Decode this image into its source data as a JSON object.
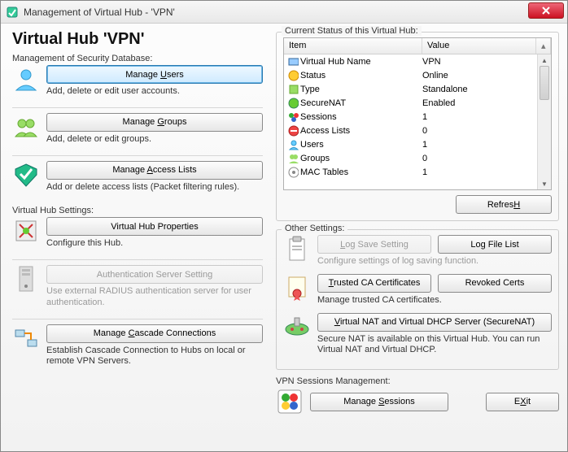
{
  "title": "Management of Virtual Hub - 'VPN'",
  "heading": "Virtual Hub 'VPN'",
  "left": {
    "security_label": "Management of Security Database:",
    "manage_users_btn": "Manage Users",
    "manage_users_u": "U",
    "manage_users_desc": "Add, delete or edit user accounts.",
    "manage_groups_btn": "Manage Groups",
    "manage_groups_u": "G",
    "manage_groups_desc": "Add, delete or edit groups.",
    "manage_acl_btn": "Manage Access Lists",
    "manage_acl_u": "A",
    "manage_acl_desc": "Add or delete access lists (Packet filtering rules).",
    "settings_label": "Virtual Hub Settings:",
    "vhub_props_btn": "Virtual Hub Properties",
    "vhub_props_desc": "Configure this Hub.",
    "auth_server_btn": "Authentication Server Setting",
    "auth_server_desc": "Use external RADIUS authentication server for user authentication.",
    "cascade_btn": "Manage Cascade Connections",
    "cascade_u": "C",
    "cascade_desc": "Establish Cascade Connection to Hubs on local or remote VPN Servers."
  },
  "right": {
    "status_label": "Current Status of this Virtual Hub:",
    "col_item": "Item",
    "col_value": "Value",
    "rows": [
      {
        "icon": "hub",
        "item": "Virtual Hub Name",
        "value": "VPN"
      },
      {
        "icon": "status",
        "item": "Status",
        "value": "Online"
      },
      {
        "icon": "type",
        "item": "Type",
        "value": "Standalone"
      },
      {
        "icon": "snat",
        "item": "SecureNAT",
        "value": "Enabled"
      },
      {
        "icon": "sess",
        "item": "Sessions",
        "value": "1"
      },
      {
        "icon": "acl",
        "item": "Access Lists",
        "value": "0"
      },
      {
        "icon": "user",
        "item": "Users",
        "value": "1"
      },
      {
        "icon": "group",
        "item": "Groups",
        "value": "0"
      },
      {
        "icon": "mac",
        "item": "MAC Tables",
        "value": "1"
      }
    ],
    "refresh_btn": "Refresh",
    "refresh_u": "H",
    "other_label": "Other Settings:",
    "log_save_btn": "Log Save Setting",
    "log_save_u": "L",
    "log_file_btn": "Log File List",
    "log_desc": "Configure settings of log saving function.",
    "trusted_ca_btn": "Trusted CA Certificates",
    "trusted_ca_u": "T",
    "revoked_btn": "Revoked Certs",
    "ca_desc": "Manage trusted CA certificates.",
    "vnat_btn": "Virtual NAT and Virtual DHCP Server (SecureNAT)",
    "vnat_u": "V",
    "vnat_desc": "Secure NAT is available on this Virtual Hub. You can run Virtual NAT and Virtual DHCP.",
    "sessions_label": "VPN Sessions Management:",
    "manage_sessions_btn": "Manage Sessions",
    "manage_sessions_u": "S",
    "exit_btn": "Exit",
    "exit_u": "X"
  }
}
